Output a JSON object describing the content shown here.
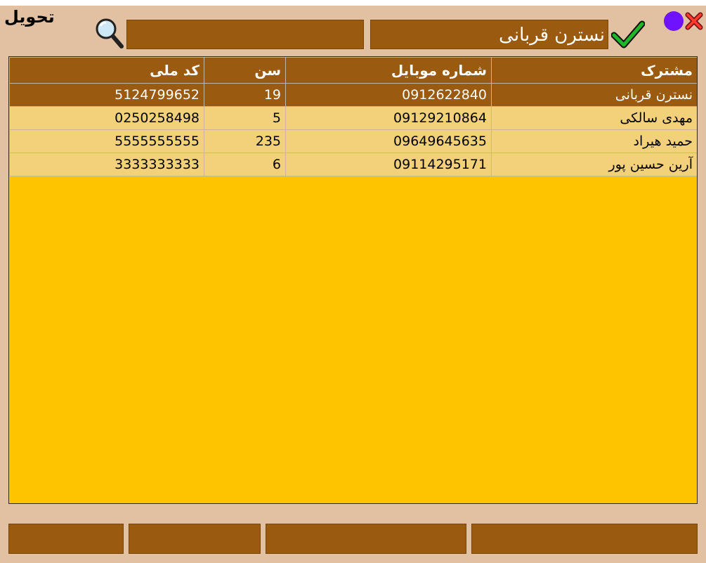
{
  "window": {
    "title": "تحویل"
  },
  "toolbar": {
    "search_value": "",
    "name_value": "نسترن قربانی",
    "colors": {
      "accent": "#9a5a10",
      "grid_bg": "#ffc400",
      "row_bg": "#f3d07a",
      "window_bg": "#e2c1a2"
    }
  },
  "table": {
    "headers": [
      "مشترک",
      "شماره موبایل",
      "سن",
      "کد ملی"
    ],
    "rows": [
      [
        "نسترن قربانی",
        "0912622840",
        "19",
        "5124799652"
      ],
      [
        "مهدی سالکی",
        "09129210864",
        "5",
        "0250258498"
      ],
      [
        "حمید هیراد",
        "09649645635",
        "235",
        "5555555555"
      ],
      [
        "آرین حسین پور",
        "09114295171",
        "6",
        "3333333333"
      ]
    ],
    "selected_row": 0
  },
  "icons": {
    "search": "magnifier-icon",
    "confirm": "check-icon",
    "status": "dot-icon",
    "close": "close-icon"
  }
}
